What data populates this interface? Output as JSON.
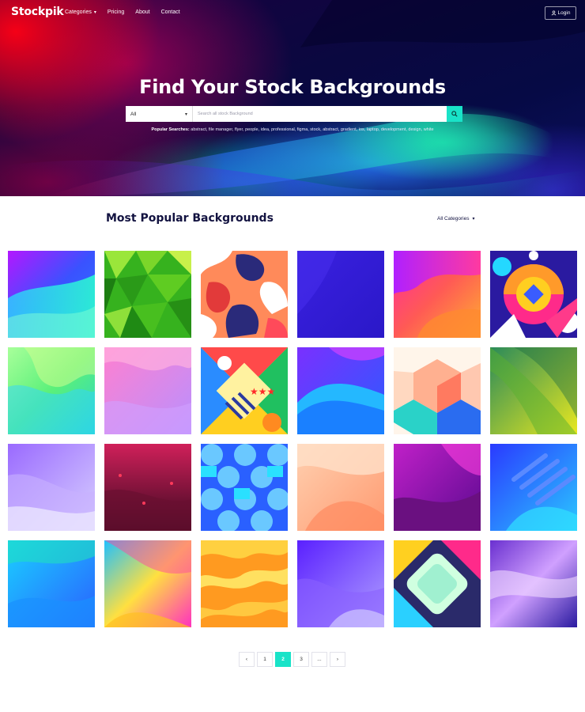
{
  "nav": {
    "logo": "Stockpik",
    "links": [
      "Categories",
      "Pricing",
      "About",
      "Contact"
    ],
    "login_label": "Login"
  },
  "hero": {
    "title": "Find Your Stock Backgrounds",
    "search": {
      "category_value": "All",
      "placeholder": "Search all stock Background"
    },
    "popular_label": "Popular Searches:",
    "popular_terms": "abstract, file manager, flyer, people, idea, professional, figma, stock, abstract, gradient, ios, laptop, development, design, white"
  },
  "section": {
    "title": "Most Popular Backgrounds",
    "filter_label": "All Categories"
  },
  "pagination": {
    "prev_icon": "chevron-left-icon",
    "pages": [
      "1",
      "2",
      "3",
      "..."
    ],
    "active_page": "2",
    "next_icon": "chevron-right-icon"
  },
  "colors": {
    "accent": "#19e3c8",
    "heading": "#121240"
  }
}
